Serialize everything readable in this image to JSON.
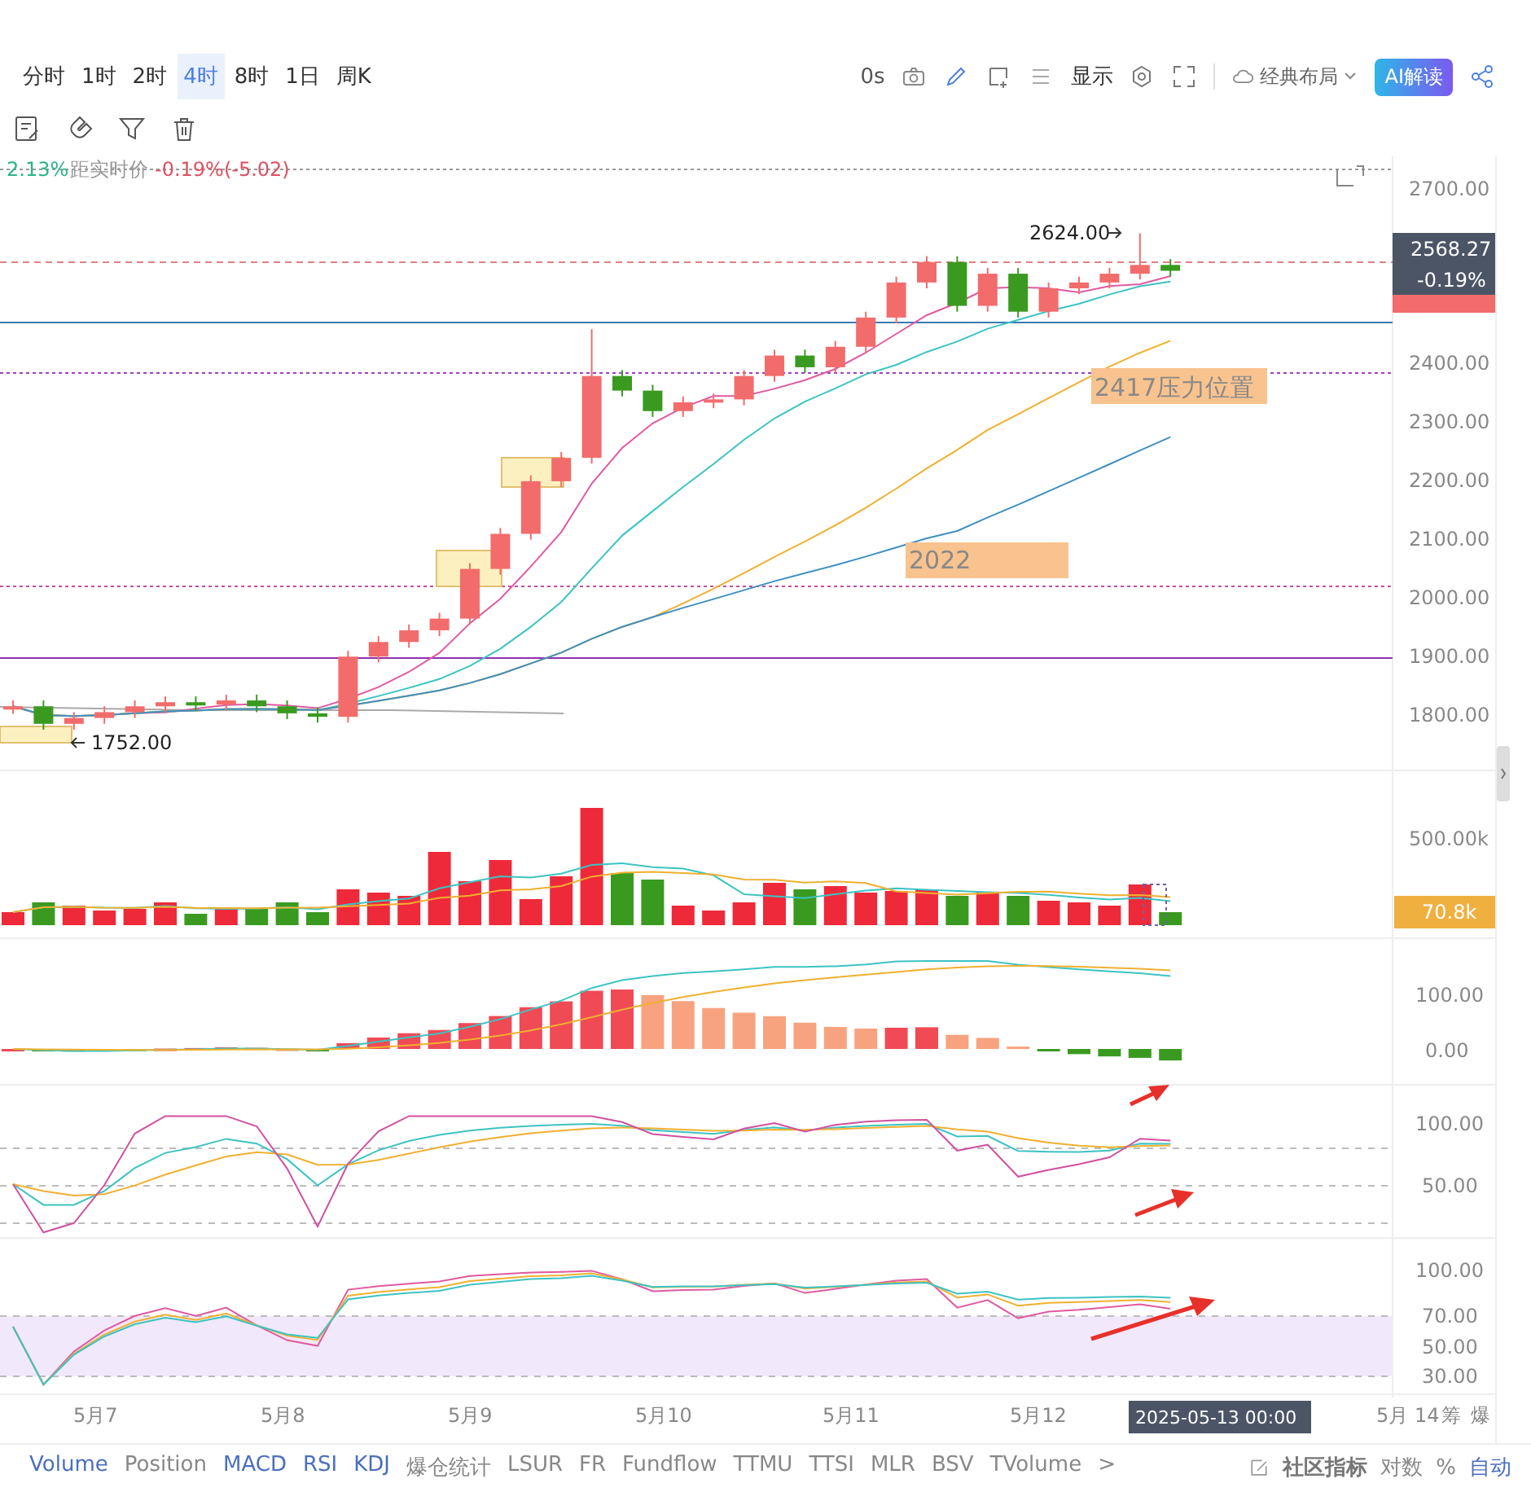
{
  "toolbar": {
    "intervals": [
      {
        "label": "分时",
        "selected": false
      },
      {
        "label": "1时",
        "selected": false
      },
      {
        "label": "2时",
        "selected": false
      },
      {
        "label": "4时",
        "selected": true
      },
      {
        "label": "8时",
        "selected": false
      },
      {
        "label": "1日",
        "selected": false
      },
      {
        "label": "周K",
        "selected": false
      }
    ],
    "countdown": "0s",
    "display": "显示",
    "layout": "经典布局",
    "ai_button": "AI解读"
  },
  "info_line": {
    "change": "2.13%",
    "label": "距实时价",
    "distance": "-0.19%(-5.02)"
  },
  "main_chart": {
    "axis_labels": [
      "2700.00",
      "2400.00",
      "2300.00",
      "2200.00",
      "2100.00",
      "2000.00",
      "1900.00",
      "1800.00"
    ],
    "price_tag": {
      "price": "2568.27",
      "change": "-0.19%"
    },
    "high_marker": "2624.00",
    "low_marker": "1752.00",
    "annotations": [
      {
        "text": "2417压力位置"
      },
      {
        "text": "2022"
      }
    ]
  },
  "volume_pane": {
    "axis_labels": [
      "500.00k"
    ],
    "current": "70.8k"
  },
  "macd_pane": {
    "axis_labels": [
      "100.00",
      "0.00"
    ]
  },
  "kdj_pane": {
    "axis_labels": [
      "100.00",
      "50.00"
    ]
  },
  "rsi_pane": {
    "axis_labels": [
      "100.00",
      "70.00",
      "50.00",
      "30.00"
    ]
  },
  "time_axis": {
    "labels": [
      "5月7",
      "5月8",
      "5月9",
      "5月10",
      "5月11",
      "5月12"
    ],
    "cursor_time": "2025-05-13 00:00",
    "next_label": "5月 14",
    "chip_label": "筹",
    "burst_label": "爆"
  },
  "indicator_tabs": [
    {
      "label": "Volume",
      "selected": true
    },
    {
      "label": "Position",
      "selected": false
    },
    {
      "label": "MACD",
      "selected": true
    },
    {
      "label": "RSI",
      "selected": true
    },
    {
      "label": "KDJ",
      "selected": true
    },
    {
      "label": "爆仓统计",
      "selected": false
    },
    {
      "label": "LSUR",
      "selected": false
    },
    {
      "label": "FR",
      "selected": false
    },
    {
      "label": "Fundflow",
      "selected": false
    },
    {
      "label": "TTMU",
      "selected": false
    },
    {
      "label": "TTSI",
      "selected": false
    },
    {
      "label": "MLR",
      "selected": false
    },
    {
      "label": "BSV",
      "selected": false
    },
    {
      "label": "TVolume",
      "selected": false
    }
  ],
  "more": ">",
  "community": "社区指标",
  "scale_options": [
    {
      "label": "对数",
      "selected": false
    },
    {
      "label": "%",
      "selected": false
    },
    {
      "label": "自动",
      "selected": true
    }
  ]
}
